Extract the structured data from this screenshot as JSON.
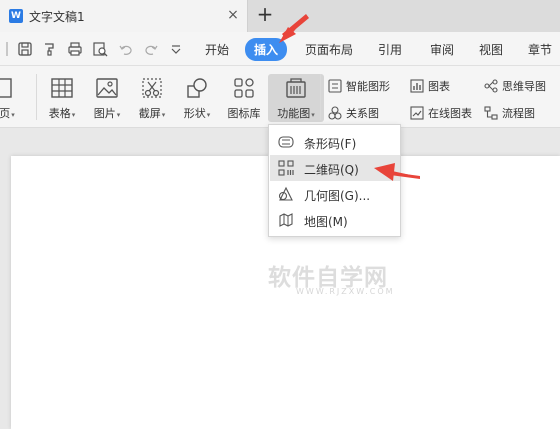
{
  "tab": {
    "doc_icon": "W",
    "title": "文字文稿1",
    "close": "×",
    "new_tab": "+"
  },
  "quick_access": [
    "save-icon",
    "format-painter-icon",
    "print-icon",
    "print-preview-icon",
    "undo-icon",
    "redo-icon",
    "customize-icon"
  ],
  "menu": {
    "items": [
      "开始",
      "插入",
      "页面布局",
      "引用",
      "审阅",
      "视图",
      "章节"
    ],
    "active": "插入",
    "accent": "#3d8df0"
  },
  "ribbon": {
    "cut_left": "页",
    "table": "表格",
    "picture": "图片",
    "screenshot": "截屏",
    "shape": "形状",
    "icon_lib": "图标库",
    "function_chart": "功能图",
    "smart_graphic": "智能图形",
    "chart": "图表",
    "mindmap": "思维导图",
    "relation": "关系图",
    "online_chart": "在线图表",
    "flowchart": "流程图"
  },
  "dropdown": {
    "items": [
      {
        "label": "条形码(F)",
        "icon": "barcode-icon"
      },
      {
        "label": "二维码(Q)",
        "icon": "qrcode-icon"
      },
      {
        "label": "几何图(G)...",
        "icon": "geometry-icon"
      },
      {
        "label": "地图(M)",
        "icon": "map-icon"
      }
    ],
    "highlighted": "二维码(Q)"
  },
  "watermark": {
    "main": "软件自学网",
    "sub": "WWW.RJZXW.COM"
  },
  "annotation_color": "#e8443a"
}
